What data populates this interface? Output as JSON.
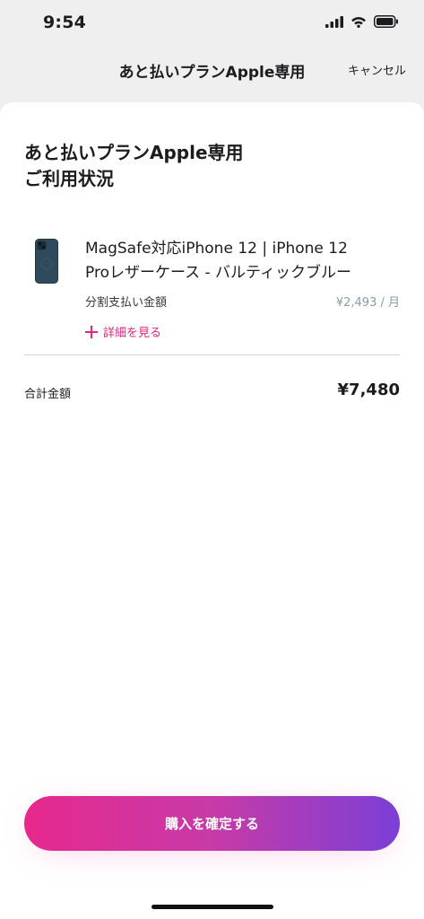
{
  "status_bar": {
    "time": "9:54",
    "icons": [
      "cellular-signal-icon",
      "wifi-icon",
      "battery-icon"
    ]
  },
  "header": {
    "title": "あと払いプランApple専用",
    "cancel_label": "キャンセル"
  },
  "main": {
    "title_line1": "あと払いプランApple専用",
    "title_line2": "ご利用状況",
    "product": {
      "name_line1": "MagSafe対応iPhone 12 | iPhone 12",
      "name_line2": "Proレザーケース - バルティックブルー",
      "installment_label": "分割支払い金額",
      "installment_value": "¥2,493 / 月",
      "details_label": "詳細を見る"
    },
    "total_label": "合計金額",
    "total_value": "¥7,480",
    "confirm_label": "購入を確定する"
  },
  "colors": {
    "accent_pink": "#e5267a",
    "button_gradient_start": "#e7288c",
    "button_gradient_end": "#7b3fd6"
  }
}
